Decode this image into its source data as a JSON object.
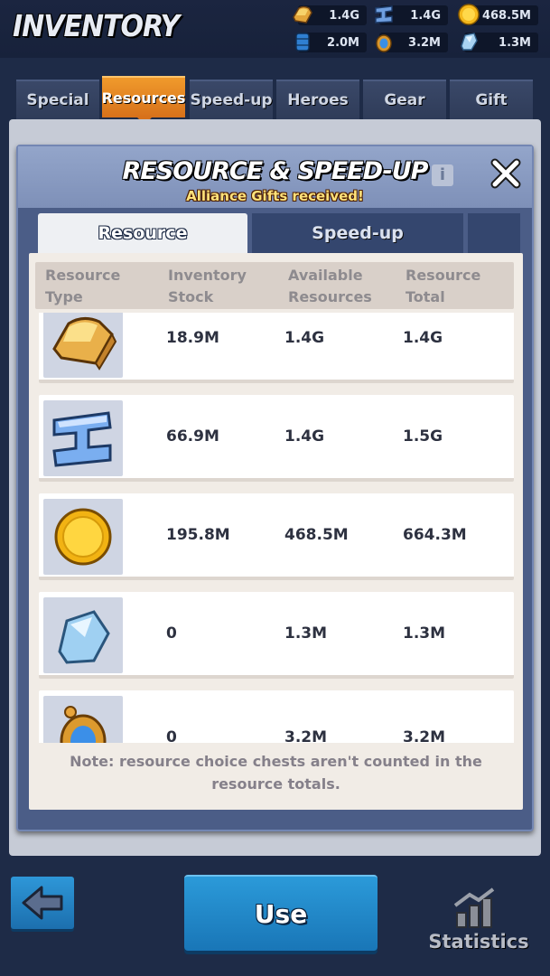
{
  "header": {
    "title": "INVENTORY",
    "resources": [
      {
        "icon": "bread-icon",
        "value": "1.4G"
      },
      {
        "icon": "iron-icon",
        "value": "1.4G"
      },
      {
        "icon": "coin-icon",
        "value": "468.5M"
      },
      {
        "icon": "barrel-icon",
        "value": "2.0M"
      },
      {
        "icon": "gem-amulet-icon",
        "value": "3.2M"
      },
      {
        "icon": "ore-icon",
        "value": "1.3M"
      }
    ]
  },
  "tabs": [
    {
      "label": "Special"
    },
    {
      "label": "Resources",
      "active": true
    },
    {
      "label": "Speed-up"
    },
    {
      "label": "Heroes"
    },
    {
      "label": "Gear"
    },
    {
      "label": "Gift"
    }
  ],
  "modal": {
    "title": "RESOURCE & SPEED-UP",
    "subtitle": "Alliance Gifts received!",
    "subtabs": [
      {
        "label": "Resource",
        "active": true
      },
      {
        "label": "Speed-up"
      }
    ],
    "columns": {
      "c1a": "Resource",
      "c1b": "Type",
      "c2a": "Inventory",
      "c2b": "Stock",
      "c3a": "Available",
      "c3b": "Resources",
      "c4a": "Resource",
      "c4b": "Total"
    },
    "rows": [
      {
        "icon": "bread-icon",
        "stock": "18.9M",
        "available": "1.4G",
        "total": "1.4G"
      },
      {
        "icon": "iron-icon",
        "stock": "66.9M",
        "available": "1.4G",
        "total": "1.5G"
      },
      {
        "icon": "coin-icon",
        "stock": "195.8M",
        "available": "468.5M",
        "total": "664.3M"
      },
      {
        "icon": "ore-icon",
        "stock": "0",
        "available": "1.3M",
        "total": "1.3M"
      },
      {
        "icon": "gem-amulet-icon",
        "stock": "0",
        "available": "3.2M",
        "total": "3.2M"
      }
    ],
    "note": "Note: resource choice chests aren't counted in the resource totals."
  },
  "footer": {
    "use_label": "Use",
    "statistics_label": "Statistics"
  }
}
